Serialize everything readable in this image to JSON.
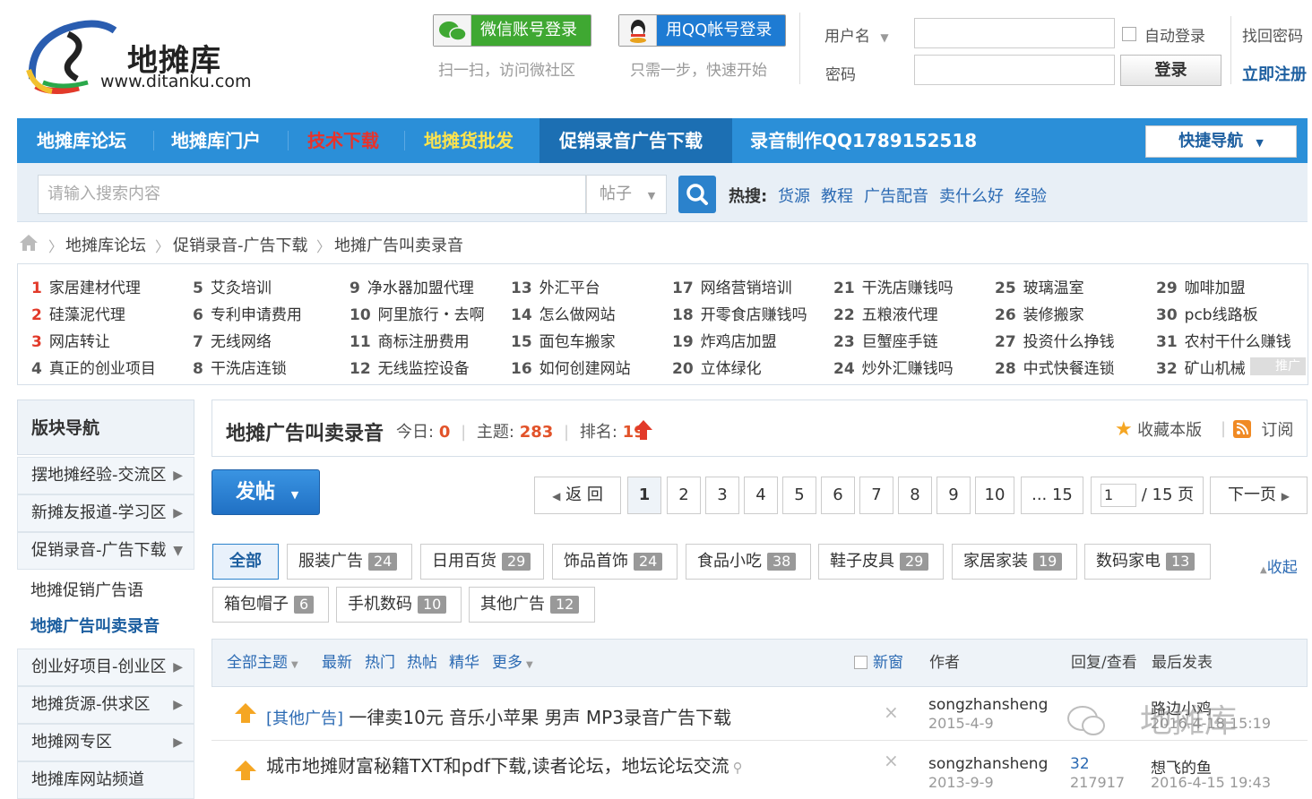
{
  "header": {
    "logo_name": "地摊库",
    "logo_url": "www.ditanku.com",
    "wechat_login": "微信账号登录",
    "wechat_hint": "扫一扫，访问微社区",
    "qq_login": "用QQ帐号登录",
    "qq_hint": "只需一步，快速开始",
    "username_label": "用户名",
    "password_label": "密码",
    "auto_login": "自动登录",
    "login_button": "登录",
    "find_password": "找回密码",
    "register": "立即注册"
  },
  "nav": {
    "items": [
      "地摊库论坛",
      "地摊库门户",
      "技术下载",
      "地摊货批发",
      "促销录音广告下载",
      "录音制作QQ1789152518"
    ],
    "quick_nav": "快捷导航"
  },
  "search": {
    "placeholder": "请输入搜索内容",
    "type": "帖子",
    "hot_label": "热搜:",
    "hot_words": [
      "货源",
      "教程",
      "广告配音",
      "卖什么好",
      "经验"
    ]
  },
  "breadcrumb": [
    "地摊库论坛",
    "促销录音-广告下载",
    "地摊广告叫卖录音"
  ],
  "keywords": [
    [
      "1",
      "家居建材代理"
    ],
    [
      "2",
      "硅藻泥代理"
    ],
    [
      "3",
      "网店转让"
    ],
    [
      "4",
      "真正的创业项目"
    ],
    [
      "5",
      "艾灸培训"
    ],
    [
      "6",
      "专利申请费用"
    ],
    [
      "7",
      "无线网络"
    ],
    [
      "8",
      "干洗店连锁"
    ],
    [
      "9",
      "净水器加盟代理"
    ],
    [
      "10",
      "阿里旅行・去啊"
    ],
    [
      "11",
      "商标注册费用"
    ],
    [
      "12",
      "无线监控设备"
    ],
    [
      "13",
      "外汇平台"
    ],
    [
      "14",
      "怎么做网站"
    ],
    [
      "15",
      "面包车搬家"
    ],
    [
      "16",
      "如何创建网站"
    ],
    [
      "17",
      "网络营销培训"
    ],
    [
      "18",
      "开零食店赚钱吗"
    ],
    [
      "19",
      "炸鸡店加盟"
    ],
    [
      "20",
      "立体绿化"
    ],
    [
      "21",
      "干洗店赚钱吗"
    ],
    [
      "22",
      "五粮液代理"
    ],
    [
      "23",
      "巨蟹座手链"
    ],
    [
      "24",
      "炒外汇赚钱吗"
    ],
    [
      "25",
      "玻璃温室"
    ],
    [
      "26",
      "装修搬家"
    ],
    [
      "27",
      "投资什么挣钱"
    ],
    [
      "28",
      "中式快餐连锁"
    ],
    [
      "29",
      "咖啡加盟"
    ],
    [
      "30",
      "pcb线路板"
    ],
    [
      "31",
      "农村干什么赚钱"
    ],
    [
      "32",
      "矿山机械"
    ]
  ],
  "keywords_ad": "推广",
  "sidebar": {
    "title": "版块导航",
    "items": [
      "摆地摊经验-交流区",
      "新摊友报道-学习区",
      "促销录音-广告下载"
    ],
    "sub_items": [
      "地摊促销广告语",
      "地摊广告叫卖录音"
    ],
    "items2": [
      "创业好项目-创业区",
      "地摊货源-供求区",
      "地摊网专区",
      "地摊库网站频道"
    ]
  },
  "forum": {
    "title": "地摊广告叫卖录音",
    "today_label": "今日:",
    "today": "0",
    "topics_label": "主题:",
    "topics": "283",
    "rank_label": "排名:",
    "rank": "19",
    "favorite": "收藏本版",
    "subscribe": "订阅"
  },
  "post_button": "发帖",
  "pagination": {
    "back": "返 回",
    "pages": [
      "1",
      "2",
      "3",
      "4",
      "5",
      "6",
      "7",
      "8",
      "9",
      "10",
      "... 15"
    ],
    "current_input": "1",
    "total": "/ 15 页",
    "next": "下一页"
  },
  "tabs": [
    {
      "label": "全部",
      "count": ""
    },
    {
      "label": "服装广告",
      "count": "24"
    },
    {
      "label": "日用百货",
      "count": "29"
    },
    {
      "label": "饰品首饰",
      "count": "24"
    },
    {
      "label": "食品小吃",
      "count": "38"
    },
    {
      "label": "鞋子皮具",
      "count": "29"
    },
    {
      "label": "家居家装",
      "count": "19"
    },
    {
      "label": "数码家电",
      "count": "13"
    },
    {
      "label": "箱包帽子",
      "count": "6"
    },
    {
      "label": "手机数码",
      "count": "10"
    },
    {
      "label": "其他广告",
      "count": "12"
    }
  ],
  "collapse": "收起",
  "list_header": {
    "all_topics": "全部主题",
    "latest": "最新",
    "hot": "热门",
    "hot_posts": "热帖",
    "digest": "精华",
    "more": "更多",
    "new_window": "新窗",
    "author": "作者",
    "replies_views": "回复/查看",
    "last_post": "最后发表"
  },
  "threads": [
    {
      "category": "[其他广告]",
      "title": "一律卖10元 音乐小苹果 男声 MP3录音广告下载",
      "author": "songzhansheng",
      "date": "2015-4-9",
      "replies": "",
      "views": "",
      "last_user": "路边小鸡",
      "last_time": "2016-4-18 15:19"
    },
    {
      "category": "",
      "title": "城市地摊财富秘籍TXT和pdf下载,读者论坛，地坛论坛交流",
      "author": "songzhansheng",
      "date": "2013-9-9",
      "replies": "32",
      "views": "217917",
      "last_user": "想飞的鱼",
      "last_time": "2016-4-15 19:43"
    }
  ],
  "watermark": "地摊库"
}
